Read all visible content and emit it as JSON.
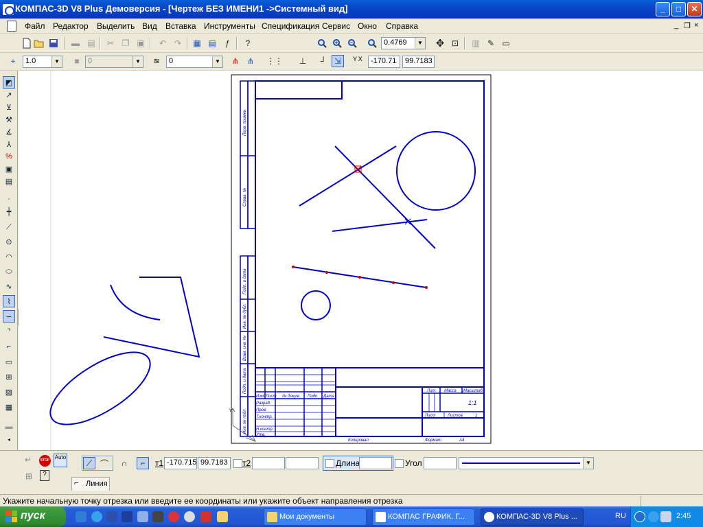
{
  "window": {
    "title": "КОМПАС-3D V8 Plus Демоверсия - [Чертеж БЕЗ ИМЕНИ1 ->Системный вид]",
    "controls": {
      "minimize": "_",
      "maximize": "□",
      "close": "✕"
    }
  },
  "menu": {
    "items": [
      "Файл",
      "Редактор",
      "Выделить",
      "Вид",
      "Вставка",
      "Инструменты",
      "Спецификация",
      "Сервис",
      "Окно",
      "Справка"
    ],
    "mdi": {
      "minimize": "_",
      "restore": "❐",
      "close": "×"
    }
  },
  "toolbar": {
    "zoom_value": "0.4769",
    "icons": [
      "new-icon",
      "open-icon",
      "save-icon",
      "print-icon",
      "cut-icon",
      "copy-icon",
      "paste-icon",
      "undo-icon",
      "redo-icon",
      "zoom-icons",
      "pan-icon"
    ]
  },
  "current_params": {
    "step": "1.0",
    "layer": "0",
    "view": "0",
    "coord_x": "-170.71",
    "coord_y": "99.7183",
    "xy_label": "Y X"
  },
  "drawing": {
    "stamp": {
      "side_labels": [
        "Перв. примен.",
        "Справ. №",
        "Подп. и дата",
        "Инв. № дубл.",
        "Взам. инв. №",
        "Подп. и дата",
        "Инв. № подл."
      ],
      "table_headers": [
        "Изм.",
        "Лист",
        "№ докум.",
        "Подп.",
        "Дата"
      ],
      "row_labels": [
        "Разраб.",
        "Пров.",
        "Т.контр.",
        "Н.контр.",
        "Утв."
      ],
      "right_headers": [
        "Лит.",
        "Масса",
        "Масштаб"
      ],
      "scale": "1:1",
      "sheet_label": "Лист",
      "sheets_label": "Листов",
      "sheets_count": "1",
      "copied": "Копировал",
      "format_label": "Формат",
      "format_value": "A4"
    }
  },
  "property_bar": {
    "t1_label": "т1",
    "t1_x": "-170.715",
    "t1_y": "99.7183",
    "t2_label": "т2",
    "t2_x": "",
    "t2_y": "",
    "length_label": "Длина",
    "length_value": "",
    "angle_label": "Угол",
    "angle_value": "",
    "auto_label": "Auto",
    "stop_label": "STOP",
    "tab_label": "Линия"
  },
  "status": {
    "message": "Укажите начальную точку отрезка или введите ее координаты или укажите объект направления отрезка"
  },
  "taskbar": {
    "start_label": "пуск",
    "tasks": [
      {
        "label": "Мои документы",
        "active": false
      },
      {
        "label": "КОМПАС ГРАФИК. Г...",
        "active": false
      },
      {
        "label": "КОМПАС-3D V8 Plus ...",
        "active": true
      }
    ],
    "lang": "RU",
    "clock": "2:45"
  },
  "colors": {
    "drawing_line": "#0000c8",
    "accent": "#0a46c9",
    "start_green": "#3c9a3c"
  }
}
